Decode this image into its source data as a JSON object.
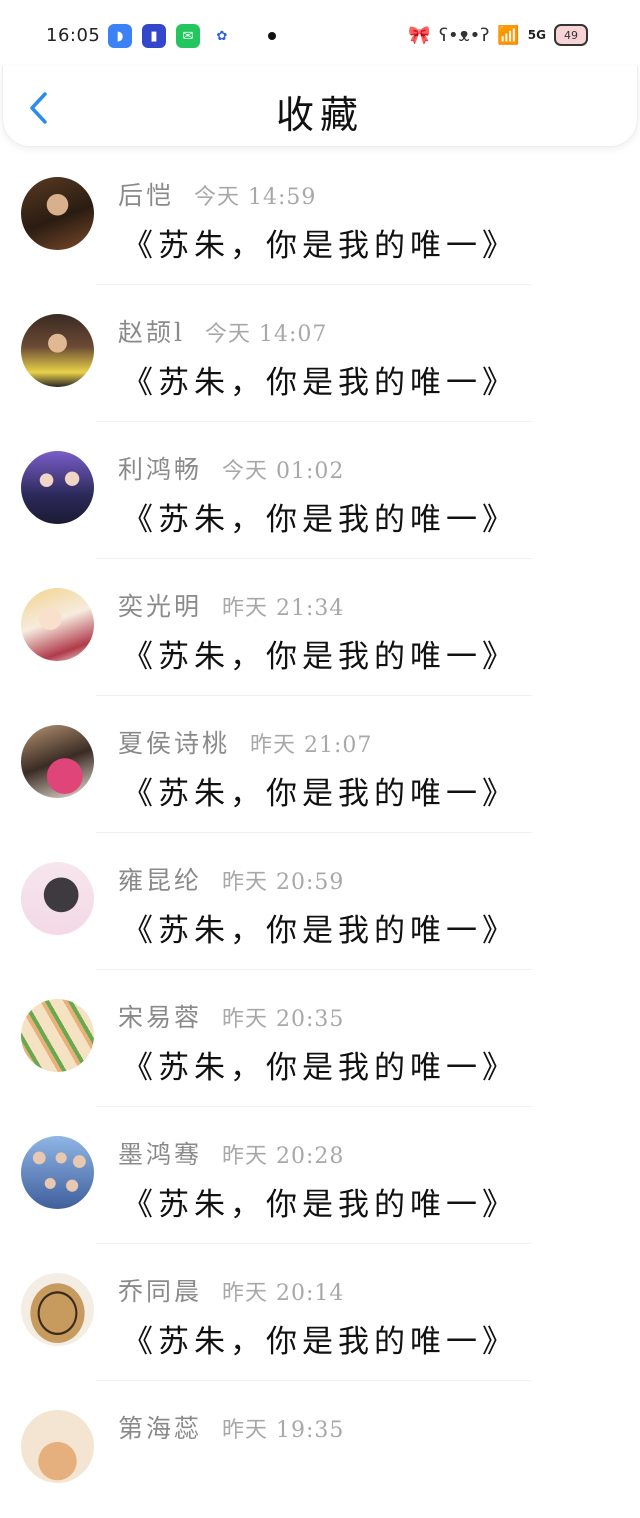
{
  "status_bar": {
    "time": "16:05",
    "network": "5G",
    "battery": "49",
    "apps": [
      {
        "icon": "browser-app-icon",
        "glyph": "◗",
        "color": "#3b82f6"
      },
      {
        "icon": "flashlight-app-icon",
        "glyph": "▮",
        "color": "#3446c9"
      },
      {
        "icon": "shopping-bag-app-icon",
        "glyph": "✉",
        "color": "#22c55e"
      },
      {
        "icon": "baidu-app-icon",
        "glyph": "✿",
        "color": "#2b5fe3"
      }
    ]
  },
  "header": {
    "title": "收藏",
    "back_icon": "chevron-left-icon",
    "accent": "#2b8cf0"
  },
  "favorites": [
    {
      "name": "后恺",
      "time": "今天 14:59",
      "message": "《苏朱，你是我的唯一》"
    },
    {
      "name": "赵颉l",
      "time": "今天 14:07",
      "message": "《苏朱，你是我的唯一》"
    },
    {
      "name": "利鸿畅",
      "time": "今天 01:02",
      "message": "《苏朱，你是我的唯一》"
    },
    {
      "name": "奕光明",
      "time": "昨天 21:34",
      "message": "《苏朱，你是我的唯一》"
    },
    {
      "name": "夏侯诗桃",
      "time": "昨天 21:07",
      "message": "《苏朱，你是我的唯一》"
    },
    {
      "name": "雍昆纶",
      "time": "昨天 20:59",
      "message": "《苏朱，你是我的唯一》"
    },
    {
      "name": "宋易蓉",
      "time": "昨天 20:35",
      "message": "《苏朱，你是我的唯一》"
    },
    {
      "name": "墨鸿骞",
      "time": "昨天 20:28",
      "message": "《苏朱，你是我的唯一》"
    },
    {
      "name": "乔同晨",
      "time": "昨天 20:14",
      "message": "《苏朱，你是我的唯一》"
    },
    {
      "name": "第海蕊",
      "time": "昨天 19:35",
      "message": ""
    }
  ]
}
